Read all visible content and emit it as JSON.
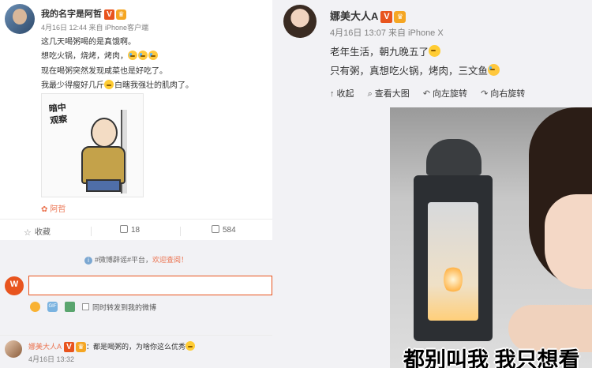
{
  "left_post": {
    "author": "我的名字是阿哲",
    "verified_badge": "V",
    "meta": "4月16日 12:44 来自 iPhone客户端",
    "lines": [
      "这几天喝粥喝的是真饿啊。",
      "想吃火锅，烧烤，烤肉，",
      "现在喝粥突然发现咸菜也是好吃了。",
      "我最少得瘦好几斤",
      "白瞎我强壮的肌肉了。"
    ],
    "comic_text": [
      "暗中",
      "观察"
    ],
    "tag": "阿哲",
    "actions": {
      "favorite": "收藏",
      "repost": "18",
      "comment": "584"
    },
    "notice": {
      "prefix": "#微博辟谣#平台，",
      "link": "欢迎查阅！"
    },
    "comment_box": {
      "repost_label": "同时转发到我的微博"
    },
    "comment": {
      "author": "娜美大人A",
      "text": "：都是喝粥的，为啥你这么优秀",
      "time": "4月16日 13:32"
    }
  },
  "right_post": {
    "author": "娜美大人A",
    "verified_badge": "V",
    "meta": "4月16日 13:07 来自 iPhone X",
    "lines": [
      "老年生活，朝九晚五了",
      "只有粥，真想吃火锅，烤肉，三文鱼"
    ],
    "tools": {
      "collapse": "收起",
      "view_large": "查看大图",
      "rotate_left": "向左旋转",
      "rotate_right": "向右旋转"
    },
    "photo_caption": "都别叫我 我只想看"
  },
  "colors": {
    "accent": "#eb7350",
    "verified": "#e8541e",
    "panel_bg": "#f2f2f5"
  }
}
